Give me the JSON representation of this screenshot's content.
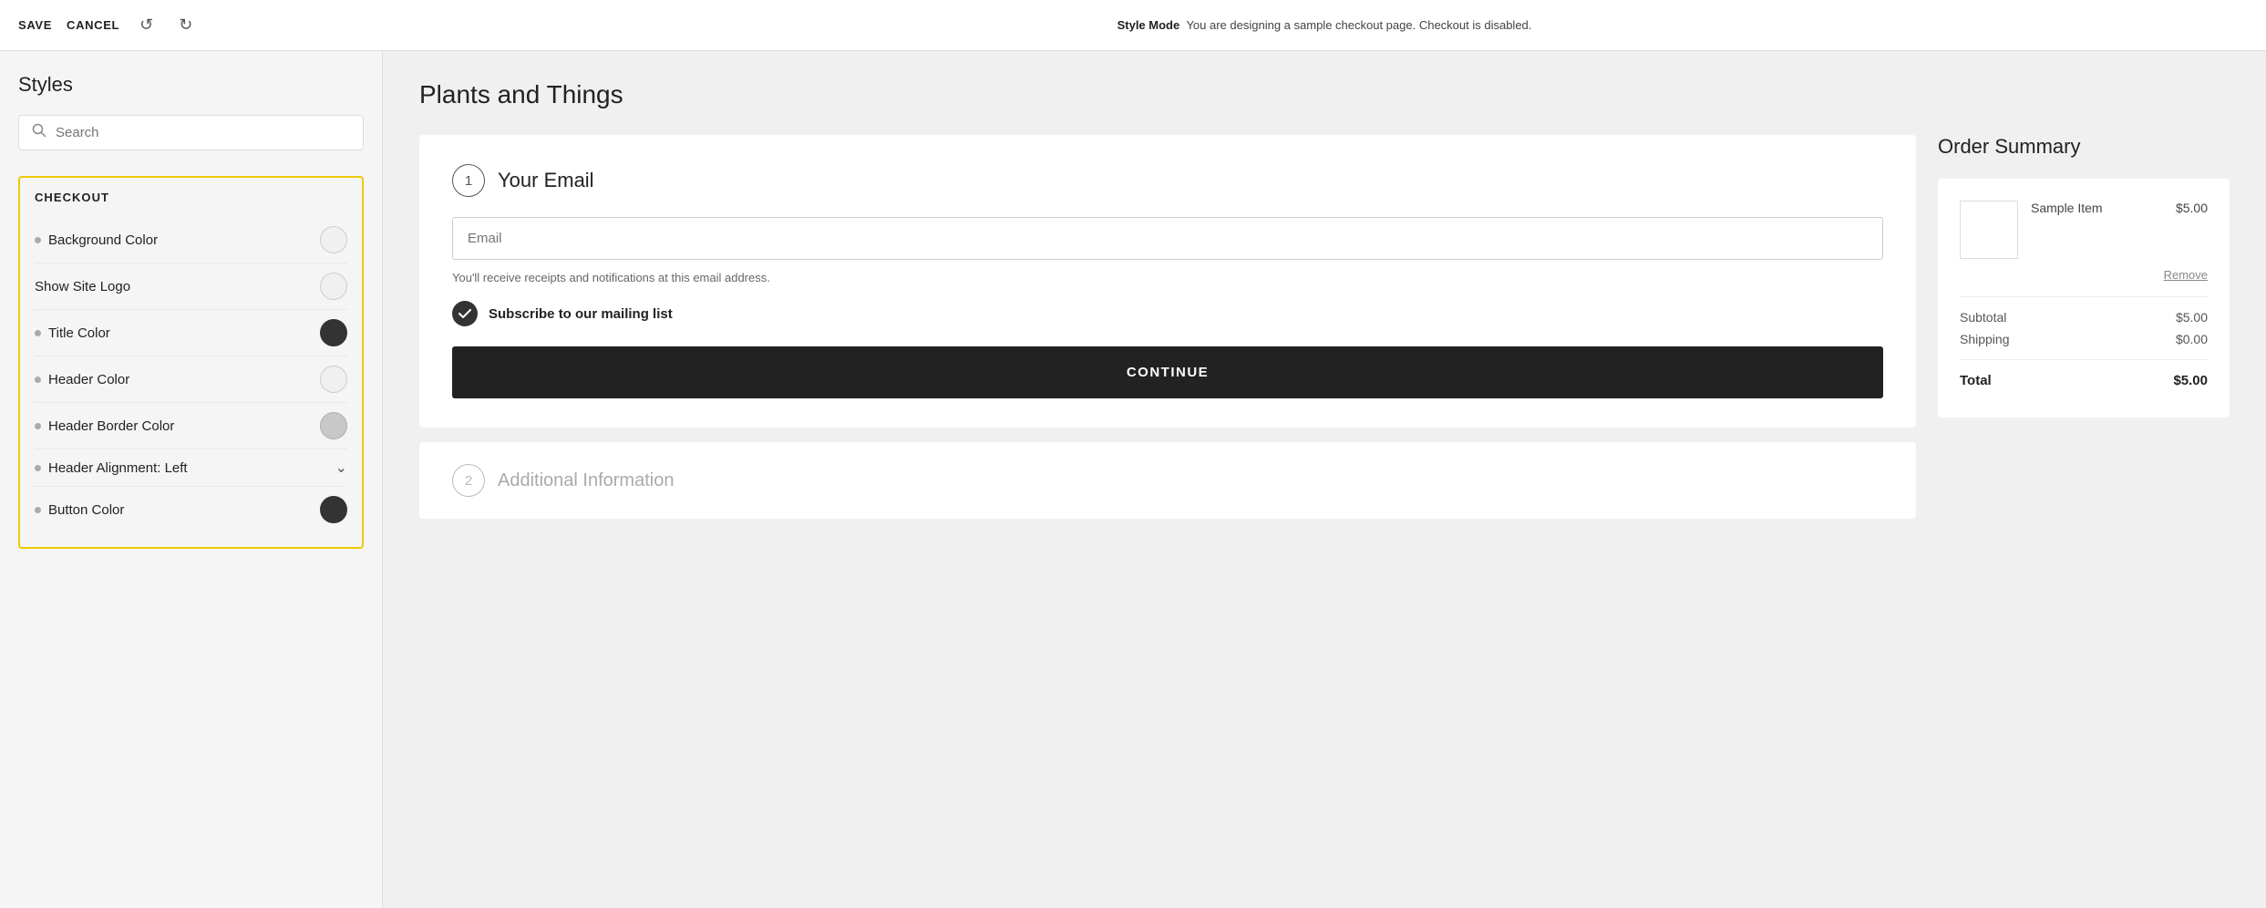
{
  "topbar": {
    "save_label": "SAVE",
    "cancel_label": "CANCEL",
    "undo_icon": "↺",
    "redo_icon": "↻",
    "mode_label": "Style Mode",
    "mode_description": "You are designing a sample checkout page. Checkout is disabled."
  },
  "sidebar": {
    "title": "Styles",
    "search_placeholder": "Search",
    "checkout_section_label": "CHECKOUT",
    "style_rows": [
      {
        "id": "background-color",
        "label": "Background Color",
        "dot": true,
        "control": "circle-light"
      },
      {
        "id": "show-site-logo",
        "label": "Show Site Logo",
        "dot": false,
        "control": "circle-light"
      },
      {
        "id": "title-color",
        "label": "Title Color",
        "dot": true,
        "control": "circle-dark"
      },
      {
        "id": "header-color",
        "label": "Header Color",
        "dot": true,
        "control": "circle-light"
      },
      {
        "id": "header-border-color",
        "label": "Header Border Color",
        "dot": true,
        "control": "circle-mid"
      },
      {
        "id": "header-alignment",
        "label": "Header Alignment: Left",
        "dot": true,
        "control": "chevron"
      },
      {
        "id": "button-color",
        "label": "Button Color",
        "dot": true,
        "control": "circle-dark"
      }
    ]
  },
  "content": {
    "page_title": "Plants and Things",
    "step1": {
      "step_number": "1",
      "title": "Your Email",
      "email_placeholder": "Email",
      "email_note": "You'll receive receipts and notifications at this email address.",
      "subscribe_label": "Subscribe to our mailing list",
      "continue_label": "CONTINUE"
    },
    "step2": {
      "step_number": "2",
      "title": "Additional Information"
    },
    "order_summary": {
      "title": "Order Summary",
      "item_name": "Sample Item",
      "item_price": "$5.00",
      "remove_label": "Remove",
      "subtotal_label": "Subtotal",
      "subtotal_value": "$5.00",
      "shipping_label": "Shipping",
      "shipping_value": "$0.00",
      "total_label": "Total",
      "total_value": "$5.00"
    }
  }
}
